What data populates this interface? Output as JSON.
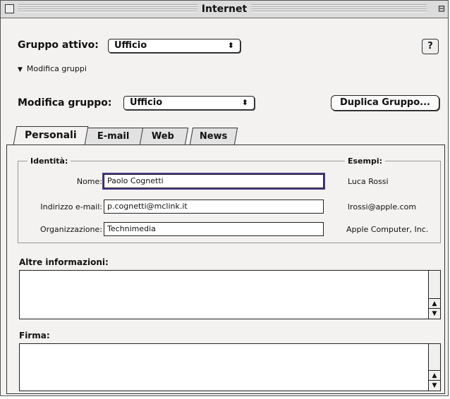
{
  "window": {
    "title": "Internet"
  },
  "active_group": {
    "label": "Gruppo attivo:",
    "value": "Ufficio"
  },
  "help_button": {
    "label": "?"
  },
  "disclosure": {
    "label": "Modifica gruppi"
  },
  "edit_group": {
    "label": "Modifica gruppo:",
    "value": "Ufficio",
    "duplicate_label": "Duplica Gruppo..."
  },
  "tabs": [
    {
      "label": "Personali",
      "active": true
    },
    {
      "label": "E-mail",
      "active": false
    },
    {
      "label": "Web",
      "active": false
    },
    {
      "label": "News",
      "active": false
    }
  ],
  "identity": {
    "title": "Identità:",
    "examples_title": "Esempi:",
    "fields": [
      {
        "label": "Nome:",
        "value": "Paolo Cognetti",
        "example": "Luca Rossi"
      },
      {
        "label": "Indirizzo e-mail:",
        "value": "p.cognetti@mclink.it",
        "example": "lrossi@apple.com"
      },
      {
        "label": "Organizzazione:",
        "value": "Technimedia",
        "example": "Apple Computer, Inc."
      }
    ]
  },
  "other_info": {
    "label": "Altre informazioni:"
  },
  "signature": {
    "label": "Firma:"
  },
  "colors": {
    "focus": "#4a3a8a",
    "window_bg": "#f4f2f0"
  }
}
